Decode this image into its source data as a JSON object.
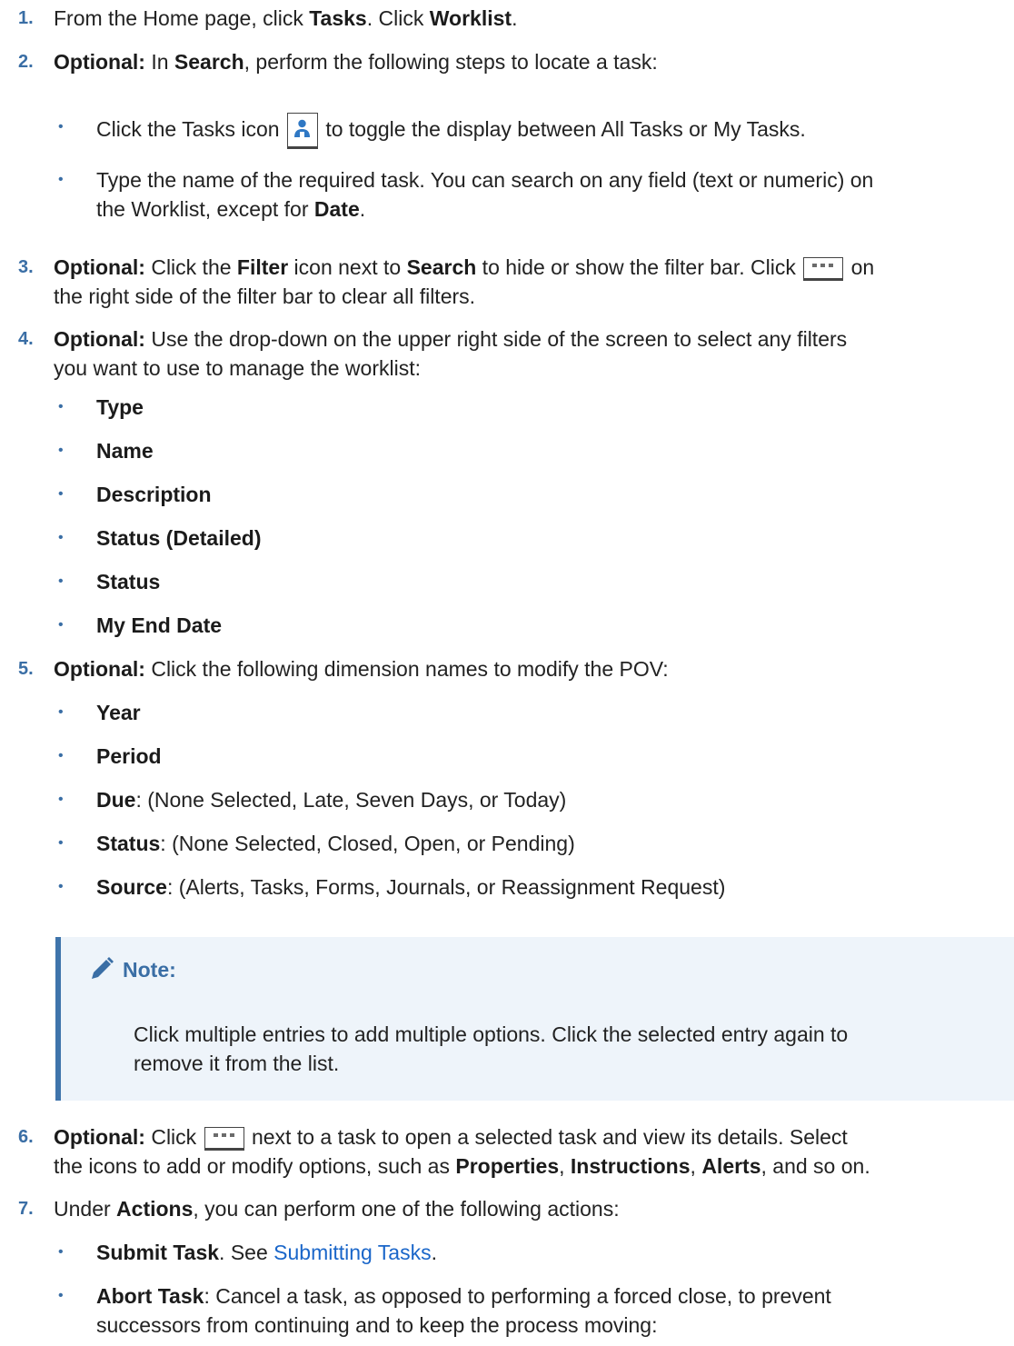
{
  "steps": {
    "s1": {
      "num": "1.",
      "a": "From the Home page, click ",
      "b1": "Tasks",
      "c": ". Click ",
      "b2": "Worklist",
      "d": "."
    },
    "s2": {
      "num": "2.",
      "opt": "Optional:",
      "a": " In ",
      "b1": "Search",
      "c": ", perform the following steps to locate a task:"
    },
    "s2_b1": {
      "a": "Click the Tasks icon ",
      "c": " to toggle the display between All Tasks or My Tasks."
    },
    "s2_b2": {
      "line1": "Type the name of the required task. You can search on any field (text or numeric) on",
      "line2a": "the Worklist, except for ",
      "b1": "Date",
      "line2c": "."
    },
    "s3": {
      "num": "3.",
      "opt": "Optional:",
      "a": " Click the ",
      "b1": "Filter",
      "c": " icon next to ",
      "b2": "Search",
      "d": " to hide or show the filter bar. Click ",
      "e": " on",
      "line2": "the right side of the filter bar to clear all filters."
    },
    "s4": {
      "num": "4.",
      "opt": "Optional:",
      "a": " Use the drop-down on the upper right side of the screen to select any filters",
      "line2": "you want to use to manage the worklist:"
    },
    "s4_items": [
      "Type",
      "Name",
      "Description",
      "Status (Detailed)",
      "Status",
      "My End Date"
    ],
    "s5": {
      "num": "5.",
      "opt": "Optional:",
      "a": " Click the following dimension names to modify the POV:"
    },
    "s5_items": {
      "year": "Year",
      "period": "Period",
      "due_b": "Due",
      "due_t": ": (None Selected, Late, Seven Days, or Today)",
      "status_b": "Status",
      "status_t": ": (None Selected, Closed, Open, or Pending)",
      "source_b": "Source",
      "source_t": ": (Alerts, Tasks, Forms, Journals, or Reassignment Request)"
    },
    "note": {
      "title": "Note:",
      "line1": "Click multiple entries to add multiple options. Click the selected entry again to",
      "line2": "remove it from the list."
    },
    "s6": {
      "num": "6.",
      "opt": "Optional:",
      "a": " Click ",
      "c": " next to a task to open a selected task and view its details. Select",
      "line2a": "the icons to add or modify options, such as ",
      "b1": "Properties",
      "sep1": ", ",
      "b2": "Instructions",
      "sep2": ", ",
      "b3": "Alerts",
      "line2d": ", and so on."
    },
    "s7": {
      "num": "7.",
      "a": "Under ",
      "b1": "Actions",
      "c": ", you can perform one of the following actions:"
    },
    "s7_b1": {
      "b": "Submit Task",
      "t": ". See ",
      "link": "Submitting Tasks",
      "end": "."
    },
    "s7_b2": {
      "b": "Abort Task",
      "t": ": Cancel a task, as opposed to performing a forced close, to prevent",
      "line2": "successors from continuing and to keep the process moving:"
    }
  },
  "bullet_char": "•",
  "icons": {
    "tasks": "user-badge-icon",
    "more": "more-dots-icon",
    "note": "pencil-icon"
  },
  "colors": {
    "step_number": "#3a6ea5",
    "link": "#1a66c9",
    "note_bg": "#eef4fa",
    "note_border": "#3f74ab"
  }
}
